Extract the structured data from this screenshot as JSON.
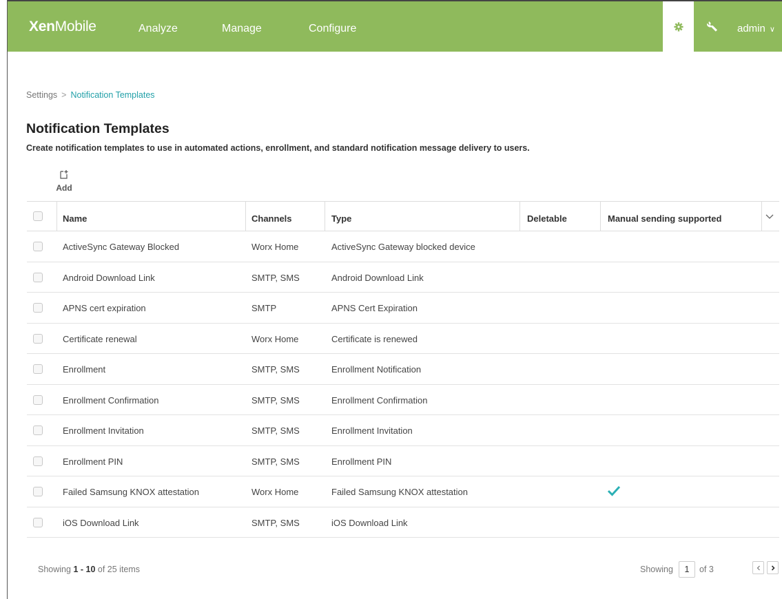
{
  "app": {
    "brand_bold": "Xen",
    "brand_light": "Mobile",
    "nav": [
      "Analyze",
      "Manage",
      "Configure"
    ],
    "user": "admin",
    "accent_color": "#8fba5c",
    "link_color": "#22a0a8"
  },
  "breadcrumb": {
    "parent": "Settings",
    "separator": ">",
    "current": "Notification Templates"
  },
  "page": {
    "title": "Notification Templates",
    "description": "Create notification templates to use in automated actions, enrollment, and standard notification message delivery to users."
  },
  "toolbar": {
    "add_label": "Add",
    "add_icon": "add-document-icon"
  },
  "table": {
    "columns": {
      "name": "Name",
      "channels": "Channels",
      "type": "Type",
      "deletable": "Deletable",
      "manual": "Manual sending supported"
    },
    "rows": [
      {
        "name": "ActiveSync Gateway Blocked",
        "channels": "Worx Home",
        "type": "ActiveSync Gateway blocked device",
        "deletable": "",
        "manual": false
      },
      {
        "name": "Android Download Link",
        "channels": "SMTP, SMS",
        "type": "Android Download Link",
        "deletable": "",
        "manual": false
      },
      {
        "name": "APNS cert expiration",
        "channels": "SMTP",
        "type": "APNS Cert Expiration",
        "deletable": "",
        "manual": false
      },
      {
        "name": "Certificate renewal",
        "channels": "Worx Home",
        "type": "Certificate is renewed",
        "deletable": "",
        "manual": false
      },
      {
        "name": "Enrollment",
        "channels": "SMTP, SMS",
        "type": "Enrollment Notification",
        "deletable": "",
        "manual": false
      },
      {
        "name": "Enrollment Confirmation",
        "channels": "SMTP, SMS",
        "type": "Enrollment Confirmation",
        "deletable": "",
        "manual": false
      },
      {
        "name": "Enrollment Invitation",
        "channels": "SMTP, SMS",
        "type": "Enrollment Invitation",
        "deletable": "",
        "manual": false
      },
      {
        "name": "Enrollment PIN",
        "channels": "SMTP, SMS",
        "type": "Enrollment PIN",
        "deletable": "",
        "manual": false
      },
      {
        "name": "Failed Samsung KNOX attestation",
        "channels": "Worx Home",
        "type": "Failed Samsung KNOX attestation",
        "deletable": "",
        "manual": true
      },
      {
        "name": "iOS Download Link",
        "channels": "SMTP, SMS",
        "type": "iOS Download Link",
        "deletable": "",
        "manual": false
      }
    ]
  },
  "footer": {
    "showing_prefix": "Showing",
    "range": "1 - 10",
    "of_text": "of 25 items",
    "page_label": "Showing",
    "page_value": "1",
    "page_total": "of 3"
  }
}
